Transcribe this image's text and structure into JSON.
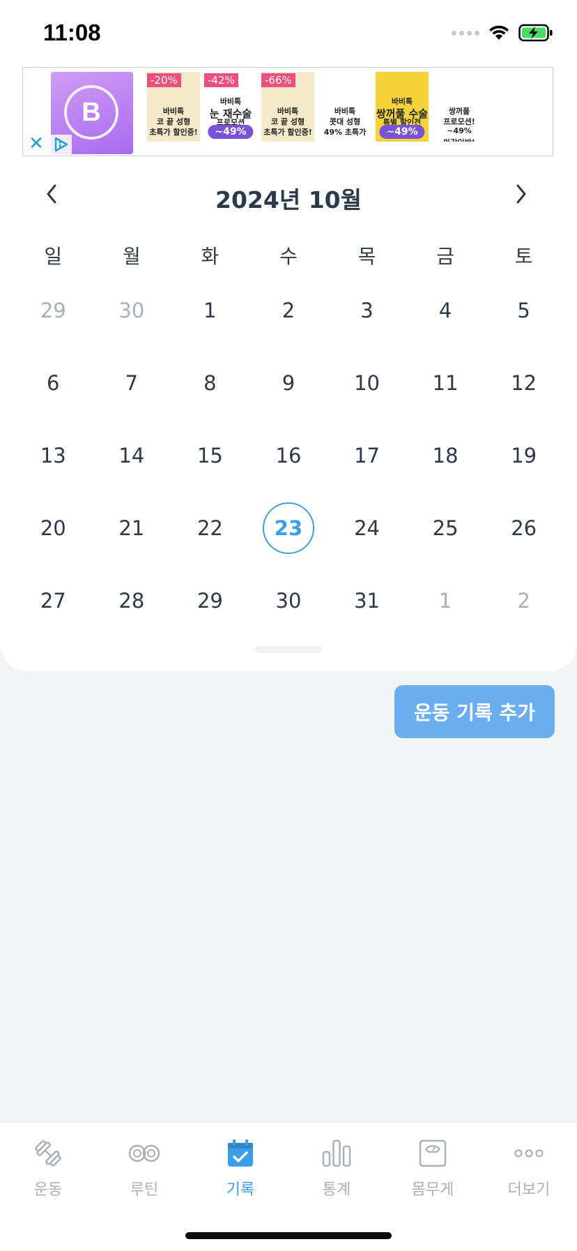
{
  "status_bar": {
    "time": "11:08"
  },
  "ad": {
    "logo_letter": "B",
    "tiles": [
      {
        "discount": "-20%",
        "lines": [
          "바비톡",
          "코 끝 성형",
          "초특가 할인중!"
        ],
        "bg": "#f6e9c9"
      },
      {
        "discount": "-42%",
        "lines": [
          "바비톡",
          "눈 재수술",
          "프로모션"
        ],
        "pill": "~49%",
        "bg": "#ffffff"
      },
      {
        "discount": "-66%",
        "lines": [
          "바비톡",
          "코 끝 성형",
          "초특가 할인중!"
        ],
        "bg": "#f6e9c9"
      },
      {
        "lines": [
          "바비톡",
          "콧대 성형",
          "49% 초특가"
        ],
        "bg": "#ffffff"
      },
      {
        "lines": [
          "바비톡",
          "쌍꺼풀 수술",
          "특별 할인전"
        ],
        "pill": "~49%",
        "bg": "#f7d33a"
      },
      {
        "lines": [
          "쌍꺼풀",
          "프로모션!",
          "~49%",
          "마감임박!"
        ],
        "bg": "#ffffff"
      }
    ]
  },
  "calendar": {
    "title": "2024년 10월",
    "weekdays": [
      "일",
      "월",
      "화",
      "수",
      "목",
      "금",
      "토"
    ],
    "weeks": [
      [
        {
          "d": "29",
          "muted": true
        },
        {
          "d": "30",
          "muted": true
        },
        {
          "d": "1"
        },
        {
          "d": "2"
        },
        {
          "d": "3"
        },
        {
          "d": "4"
        },
        {
          "d": "5"
        }
      ],
      [
        {
          "d": "6"
        },
        {
          "d": "7"
        },
        {
          "d": "8"
        },
        {
          "d": "9"
        },
        {
          "d": "10"
        },
        {
          "d": "11"
        },
        {
          "d": "12"
        }
      ],
      [
        {
          "d": "13"
        },
        {
          "d": "14"
        },
        {
          "d": "15"
        },
        {
          "d": "16"
        },
        {
          "d": "17"
        },
        {
          "d": "18"
        },
        {
          "d": "19"
        }
      ],
      [
        {
          "d": "20"
        },
        {
          "d": "21"
        },
        {
          "d": "22"
        },
        {
          "d": "23",
          "today": true
        },
        {
          "d": "24"
        },
        {
          "d": "25"
        },
        {
          "d": "26"
        }
      ],
      [
        {
          "d": "27"
        },
        {
          "d": "28"
        },
        {
          "d": "29"
        },
        {
          "d": "30"
        },
        {
          "d": "31"
        },
        {
          "d": "1",
          "muted": true
        },
        {
          "d": "2",
          "muted": true
        }
      ]
    ]
  },
  "actions": {
    "add_record_label": "운동 기록 추가"
  },
  "tab_bar": {
    "tabs": [
      {
        "label": "운동",
        "icon": "dumbbell-icon",
        "active": false
      },
      {
        "label": "루틴",
        "icon": "infinity-icon",
        "active": false
      },
      {
        "label": "기록",
        "icon": "calendar-check-icon",
        "active": true
      },
      {
        "label": "통계",
        "icon": "bar-chart-icon",
        "active": false
      },
      {
        "label": "몸무게",
        "icon": "scale-icon",
        "active": false
      },
      {
        "label": "더보기",
        "icon": "more-dots-icon",
        "active": false
      }
    ]
  },
  "colors": {
    "accent": "#3b9ee8",
    "button": "#6aaef0",
    "muted": "#a9b0b8",
    "background": "#f3f4f6"
  }
}
